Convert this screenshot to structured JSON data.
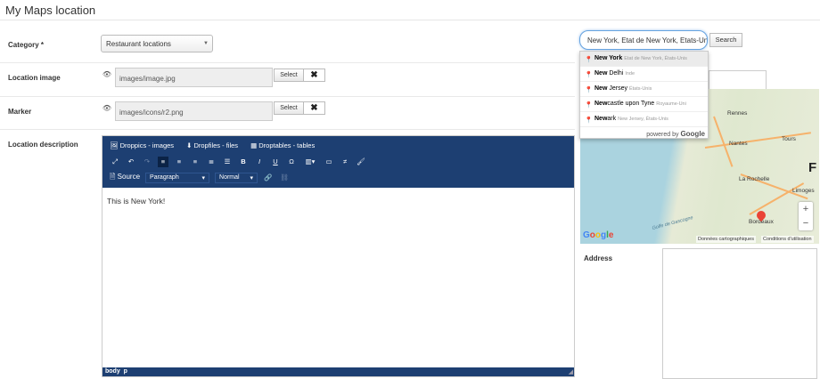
{
  "page": {
    "title": "My Maps location"
  },
  "form": {
    "category": {
      "label": "Category *",
      "value": "Restaurant locations"
    },
    "location_image": {
      "label": "Location image",
      "value": "images/image.jpg",
      "select_label": "Select",
      "clear_label": "✖"
    },
    "marker": {
      "label": "Marker",
      "value": "images/icons/r2.png",
      "select_label": "Select",
      "clear_label": "✖"
    },
    "description": {
      "label": "Location description"
    }
  },
  "editor": {
    "plugins": [
      "Droppics - images",
      "Dropfiles - files",
      "Droptables - tables"
    ],
    "source_label": "Source",
    "format_select": "Paragraph",
    "size_select": "Normal",
    "content": "This is New York!",
    "path": [
      "body",
      "p"
    ]
  },
  "search": {
    "value": "New York, Etat de New York, Etats-Unis",
    "button_label": "Search",
    "suggestions": [
      {
        "match": "New York",
        "rest": "",
        "secondary": "Etat de New York, États-Unis"
      },
      {
        "match": "New",
        "rest": " Delhi",
        "secondary": "Inde"
      },
      {
        "match": "New",
        "rest": " Jersey",
        "secondary": "États-Unis"
      },
      {
        "match": "New",
        "rest": "castle upon Tyne",
        "secondary": "Royaume-Uni"
      },
      {
        "match": "New",
        "rest": "ark",
        "secondary": "New Jersey, États-Unis"
      }
    ],
    "powered_by": "powered by",
    "powered_brand": "Google"
  },
  "map": {
    "cities": [
      "Rennes",
      "Nantes",
      "Tours",
      "La Rochelle",
      "Limoges",
      "Bordeaux"
    ],
    "sea_label": "Golfe de Gascogne",
    "logo": "Google",
    "data_credit": "Données cartographiques",
    "terms": "Conditions d'utilisation",
    "zoom_in": "+",
    "zoom_out": "−",
    "edge_letter": "F"
  },
  "address": {
    "label": "Address"
  },
  "colors": {
    "toolbar": "#1d3f72",
    "accent": "#66a3e0",
    "pin": "#ea4335"
  }
}
